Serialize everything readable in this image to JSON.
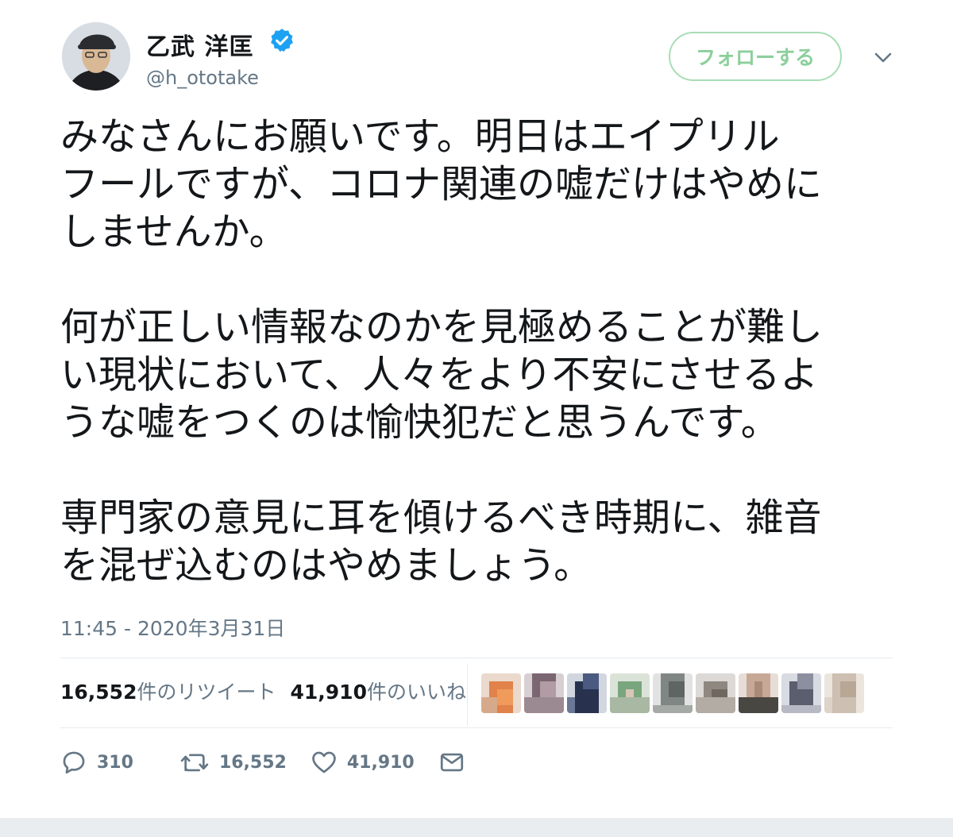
{
  "author": {
    "name": "乙武 洋匡",
    "handle": "@h_ototake",
    "verified": true,
    "avatar_icon": "profile-photo"
  },
  "header": {
    "follow_label": "フォローする",
    "menu_icon": "chevron-down-icon"
  },
  "tweet": {
    "paragraphs": [
      "みなさんにお願いです。明日はエイプリル\nフールですが、コロナ関連の嘘だけはやめに\nしませんか。",
      "何が正しい情報なのかを見極めることが難し\nい現状において、人々をより不安にさせるよ\nうな嘘をつくのは愉快犯だと思うんです。",
      "専門家の意見に耳を傾けるべき時期に、雑音\nを混ぜ込むのはやめましょう。"
    ],
    "timestamp": "11:45 - 2020年3月31日"
  },
  "stats": {
    "retweets_num": "16,552",
    "retweets_label": "件のリツイート",
    "likes_num": "41,910",
    "likes_label": "件のいいね"
  },
  "actions": {
    "reply_count": "310",
    "retweet_count": "16,552",
    "like_count": "41,910"
  },
  "colors": {
    "follow_green": "#8ccf9c",
    "muted_text": "#657786",
    "verified_blue": "#1da1f2"
  }
}
